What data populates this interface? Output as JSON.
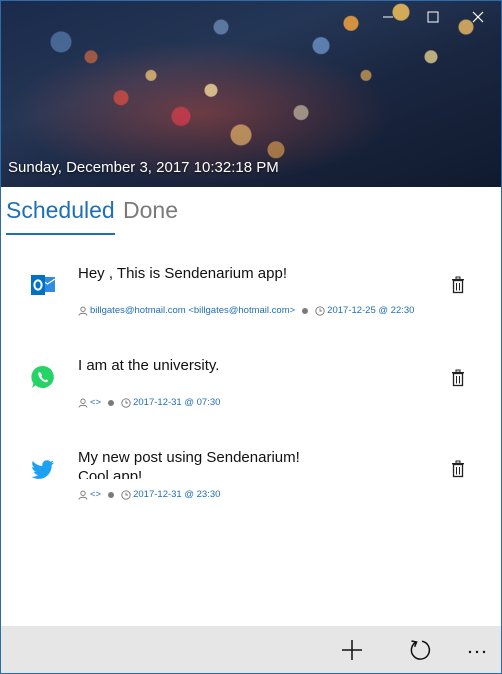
{
  "header": {
    "datetime": "Sunday, December 3, 2017 10:32:18 PM"
  },
  "window_controls": {
    "minimize_icon": "minimize-icon",
    "maximize_icon": "maximize-icon",
    "close_icon": "close-icon"
  },
  "tabs": [
    {
      "label": "Scheduled",
      "active": true
    },
    {
      "label": "Done",
      "active": false
    }
  ],
  "messages": [
    {
      "service": "outlook",
      "icon": "outlook-icon",
      "title": "Hey , This is Sendenarium app!",
      "recipient": "billgates@hotmail.com <billgates@hotmail.com>",
      "schedule": "2017-12-25 @ 22:30"
    },
    {
      "service": "whatsapp",
      "icon": "whatsapp-icon",
      "title": "I am at the university.",
      "recipient": "<>",
      "schedule": "2017-12-31 @ 07:30"
    },
    {
      "service": "twitter",
      "icon": "twitter-icon",
      "title": "My new post using Sendenarium!\nCool app!",
      "recipient": "<>",
      "schedule": "2017-12-31 @ 23:30"
    }
  ],
  "appbar": {
    "add_icon": "add-icon",
    "refresh_icon": "refresh-icon",
    "more_icon": "more-icon"
  },
  "colors": {
    "accent": "#1e6fb5",
    "outlook": "#0072c6",
    "whatsapp": "#25d366",
    "twitter": "#1da1f2",
    "appbar": "#e6e6e6"
  }
}
